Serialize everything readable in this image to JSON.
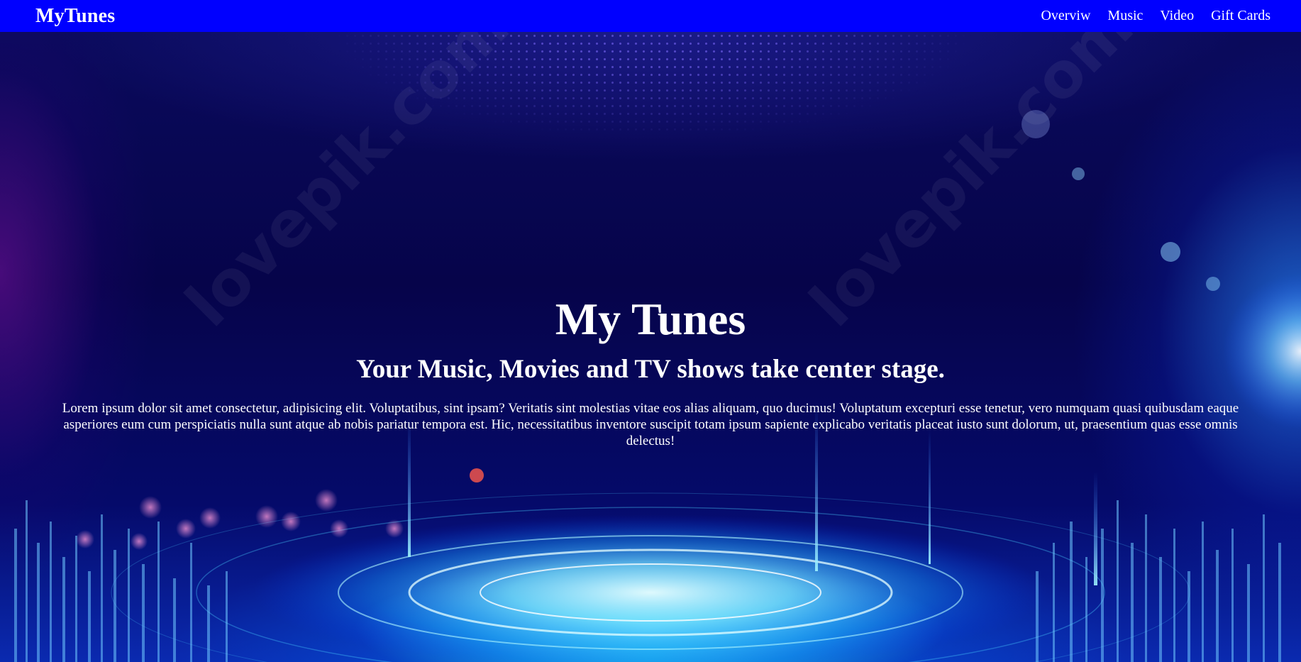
{
  "navbar": {
    "brand": "MyTunes",
    "links": [
      "Overviw",
      "Music",
      "Video",
      "Gift Cards"
    ]
  },
  "hero": {
    "title": "My Tunes",
    "subtitle": "Your Music, Movies and TV shows take center stage.",
    "text": "Lorem ipsum dolor sit amet consectetur, adipisicing elit. Voluptatibus, sint ipsam? Veritatis sint molestias vitae eos alias aliquam, quo ducimus! Voluptatum excepturi esse tenetur, vero numquam quasi quibusdam eaque asperiores eum cum perspiciatis nulla sunt atque ab nobis pariatur tempora est. Hic, necessitatibus inventore suscipit totam ipsum sapiente explicabo veritatis placeat iusto sunt dolorum, ut, praesentium quas esse omnis delectus!",
    "watermark": "lovepik.com"
  },
  "colors": {
    "navbar_bg": "#0000ff",
    "text": "#ffffff",
    "hero_bg": "#06044a",
    "glow": "#00c8ff"
  }
}
